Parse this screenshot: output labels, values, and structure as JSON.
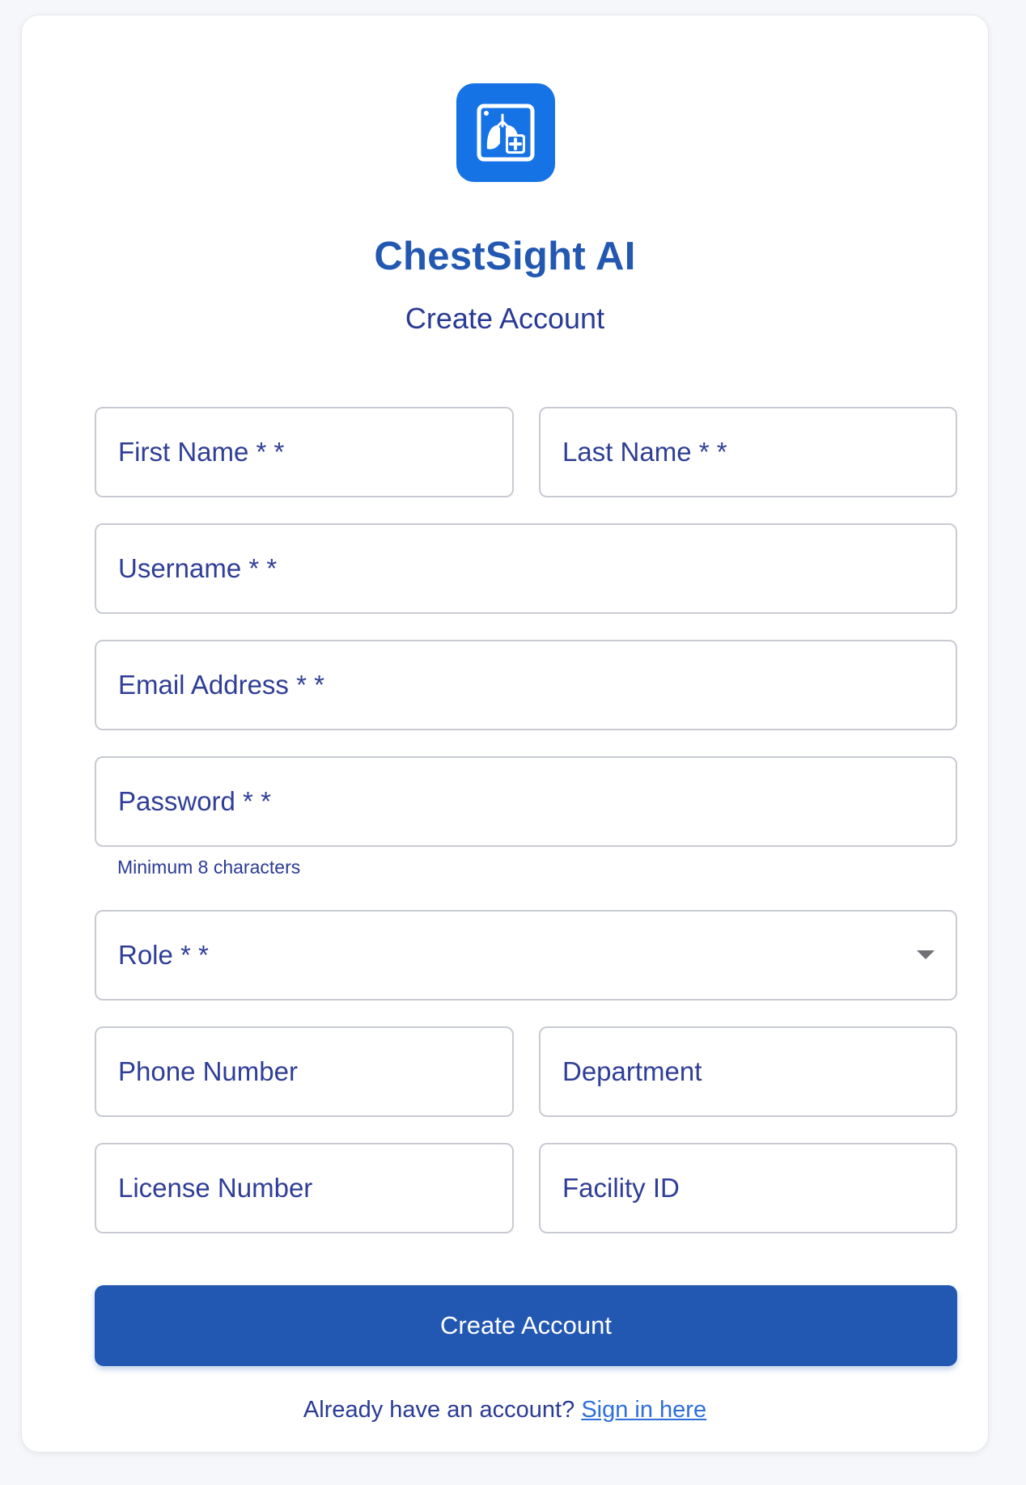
{
  "brand": {
    "logo_icon": "lungs-xray-icon",
    "app_name": "ChestSight AI",
    "subtitle": "Create Account",
    "accent_color": "#1673e6",
    "primary_color": "#2358b2"
  },
  "form": {
    "first_name": {
      "placeholder": "First Name * *",
      "value": ""
    },
    "last_name": {
      "placeholder": "Last Name * *",
      "value": ""
    },
    "username": {
      "placeholder": "Username * *",
      "value": ""
    },
    "email": {
      "placeholder": "Email Address * *",
      "value": ""
    },
    "password": {
      "placeholder": "Password * *",
      "value": "",
      "helper": "Minimum 8 characters"
    },
    "role": {
      "label": "Role * *",
      "selected": "",
      "icon": "chevron-down-icon"
    },
    "phone": {
      "placeholder": "Phone Number",
      "value": ""
    },
    "department": {
      "placeholder": "Department",
      "value": ""
    },
    "license": {
      "placeholder": "License Number",
      "value": ""
    },
    "facility": {
      "placeholder": "Facility ID",
      "value": ""
    }
  },
  "actions": {
    "submit_label": "Create Account",
    "signin_prompt": "Already have an account?",
    "signin_link": "Sign in here"
  }
}
